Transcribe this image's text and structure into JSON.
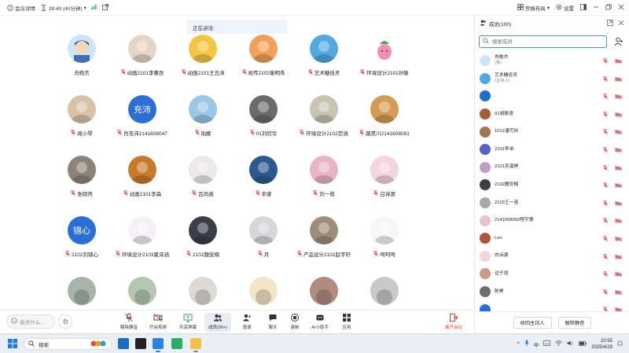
{
  "titlebar": {
    "meeting_details": "会议详情",
    "timer": "28:40 (40分钟)",
    "layout_label": "宫格布局",
    "settings_label": "设置"
  },
  "speaking": {
    "label": "正在讲话:"
  },
  "tiles": [
    {
      "name": "肖皓杰",
      "mic": false,
      "av": "cartoon-boy",
      "color": "#cfe5f7"
    },
    {
      "name": "动画2101李蕙孜",
      "mic": true,
      "av": "portrait",
      "color": "#e6d4c7"
    },
    {
      "name": "动画2101王丑涛",
      "mic": true,
      "av": "buddha",
      "color": "#f2c744"
    },
    {
      "name": "视传2103谢明秀",
      "mic": true,
      "av": "castle",
      "color": "#f0a15a"
    },
    {
      "name": "艺术糖佳灵",
      "mic": true,
      "av": "tower",
      "color": "#53a8e2"
    },
    {
      "name": "环境设计2101孙敏",
      "mic": true,
      "av": "radish",
      "color": "#f3f3f3"
    },
    {
      "name": "闻小琴",
      "mic": true,
      "av": "dog",
      "color": "#d8c3a8"
    },
    {
      "name": "肖充沛2141608047",
      "mic": true,
      "av": "text",
      "text": "充沛",
      "color": "#2b6fd6"
    },
    {
      "name": "珀娜",
      "mic": true,
      "av": "cat",
      "color": "#9cc6e6"
    },
    {
      "name": "01刘欣华",
      "mic": true,
      "av": "girl-dark",
      "color": "#6b6b6b"
    },
    {
      "name": "环境设计2102范涵",
      "mic": true,
      "av": "man-yard",
      "color": "#c8c3b3"
    },
    {
      "name": "路昊川2141608091",
      "mic": true,
      "av": "teddy",
      "color": "#d59b55"
    },
    {
      "name": "张硕然",
      "mic": true,
      "av": "boy",
      "color": "#8b8378"
    },
    {
      "name": "动画2101李森",
      "mic": true,
      "av": "tiger",
      "color": "#c77a2a"
    },
    {
      "name": "吕尚真",
      "mic": true,
      "av": "girl-light",
      "color": "#ece8ea"
    },
    {
      "name": "宋睿",
      "mic": true,
      "av": "shark",
      "color": "#2c5a8f"
    },
    {
      "name": "刘一萌",
      "mic": true,
      "av": "anime-pink",
      "color": "#e9b4c6"
    },
    {
      "name": "白诗源",
      "mic": true,
      "av": "pink-pattern",
      "color": "#f4d6df"
    },
    {
      "name": "2102刘锦心",
      "mic": true,
      "av": "text",
      "text": "锦心",
      "color": "#2b6fd6"
    },
    {
      "name": "环境设计2103夏泽涵",
      "mic": true,
      "av": "cartoon-group",
      "color": "#f6f0f6"
    },
    {
      "name": "2102魏安楠",
      "mic": true,
      "av": "anime-dark",
      "color": "#3a3e48"
    },
    {
      "name": "月",
      "mic": true,
      "av": "anime-white",
      "color": "#d7d7d9"
    },
    {
      "name": "产品设计2102赵宇轩",
      "mic": true,
      "av": "man-glasses",
      "color": "#9f8d7c"
    },
    {
      "name": "呵呵呵",
      "mic": true,
      "av": "sketch",
      "color": "#f7f7f7"
    },
    {
      "name": "",
      "mic": false,
      "av": "partial",
      "color": "#a6b5a8"
    },
    {
      "name": "",
      "mic": false,
      "av": "partial",
      "color": "#b5c7b3"
    },
    {
      "name": "",
      "mic": false,
      "av": "partial",
      "color": "#dedad3"
    },
    {
      "name": "",
      "mic": false,
      "av": "partial",
      "color": "#f4e5c8"
    },
    {
      "name": "",
      "mic": false,
      "av": "partial",
      "color": "#b18c7d"
    },
    {
      "name": "",
      "mic": false,
      "av": "partial",
      "color": "#c9c9c9"
    }
  ],
  "toolbar": {
    "chat_placeholder": "说点什么...",
    "tools": [
      {
        "label": "解除静音",
        "icon": "mic-off-icon"
      },
      {
        "label": "开启视频",
        "icon": "camera-off-icon"
      },
      {
        "label": "共享屏幕",
        "icon": "share-screen-icon"
      },
      {
        "label": "成员(99+)",
        "icon": "members-icon"
      },
      {
        "label": "邀请",
        "icon": "invite-icon"
      },
      {
        "label": "聊天",
        "icon": "chat-icon"
      },
      {
        "label": "录制",
        "icon": "record-icon"
      },
      {
        "label": "AI小助手",
        "icon": "ai-assistant-icon"
      },
      {
        "label": "应用",
        "icon": "apps-icon"
      }
    ],
    "leave": "离开会议"
  },
  "panel": {
    "title": "成员(100)",
    "search_placeholder": "搜索成员",
    "members": [
      {
        "name": "肖皓杰",
        "sub": "(我)",
        "color": "#cfe5f7"
      },
      {
        "name": "艺术糖佳灵",
        "sub": "(主持人)",
        "color": "#53a8e2"
      },
      {
        "name": ".",
        "sub": "",
        "color": "#1f6fd0"
      },
      {
        "name": "01胡振语",
        "sub": "",
        "color": "#a65c36"
      },
      {
        "name": "1012潘可欣",
        "sub": "",
        "color": "#a4744c"
      },
      {
        "name": "2101李卓",
        "sub": "",
        "color": "#5860c7"
      },
      {
        "name": "2101苏温婷",
        "sub": "",
        "color": "#b9a3c0"
      },
      {
        "name": "2102魏安楠",
        "sub": "",
        "color": "#3a3e48"
      },
      {
        "name": "2103王一诺",
        "sub": "",
        "color": "#a8a8a8"
      },
      {
        "name": "2141608092程宇惠",
        "sub": "",
        "color": "#e4c6c8"
      },
      {
        "name": "Len",
        "sub": "",
        "color": "#b0523c"
      },
      {
        "name": "白诗源",
        "sub": "",
        "color": "#f4d6df"
      },
      {
        "name": "边子瑄",
        "sub": "",
        "color": "#c89a8a"
      },
      {
        "name": "陈昊",
        "sub": "",
        "color": "#6d6d6d"
      },
      {
        "name": "",
        "sub": "",
        "color": "#2b6fd6"
      }
    ],
    "reclaim_host": "收回主持人",
    "unmute_all": "解除静音"
  },
  "taskbar": {
    "search_label": "搜索",
    "ime": "中",
    "time": "20:55",
    "date": "2025/4/29"
  }
}
